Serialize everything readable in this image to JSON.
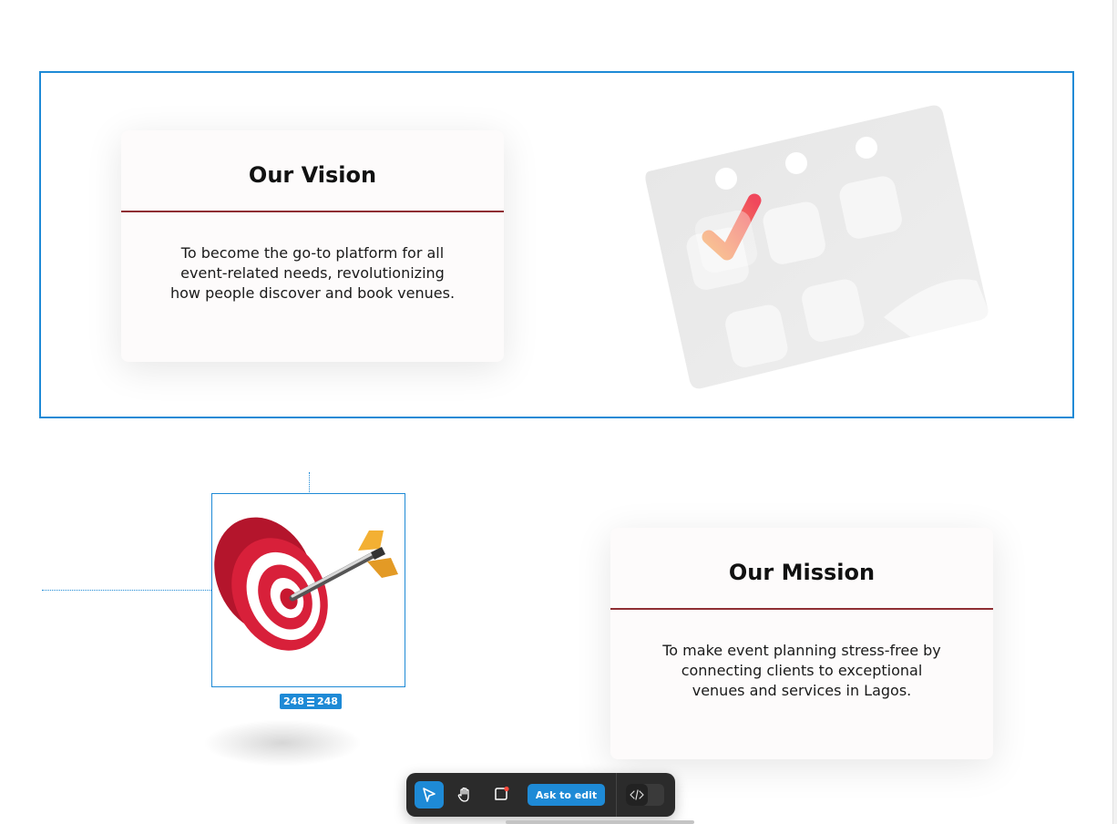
{
  "vision": {
    "title": "Our Vision",
    "body": "To become the go-to platform for all event-related needs, revolutionizing how people discover and book venues."
  },
  "mission": {
    "title": "Our Mission",
    "body": "To make event planning stress-free by connecting clients to exceptional venues and services in Lagos."
  },
  "selection": {
    "width_label": "248",
    "height_label": "248"
  },
  "toolbar": {
    "ask_to_edit_label": "Ask to edit",
    "select_tool_icon": "pointer-icon",
    "hand_tool_icon": "hand-icon",
    "comment_tool_icon": "comment-icon",
    "code_toggle_icon": "code-icon"
  },
  "colors": {
    "accent": "#1e8ad6",
    "card_rule": "#8f2e33",
    "toolbar_bg": "#2b2b2b"
  }
}
